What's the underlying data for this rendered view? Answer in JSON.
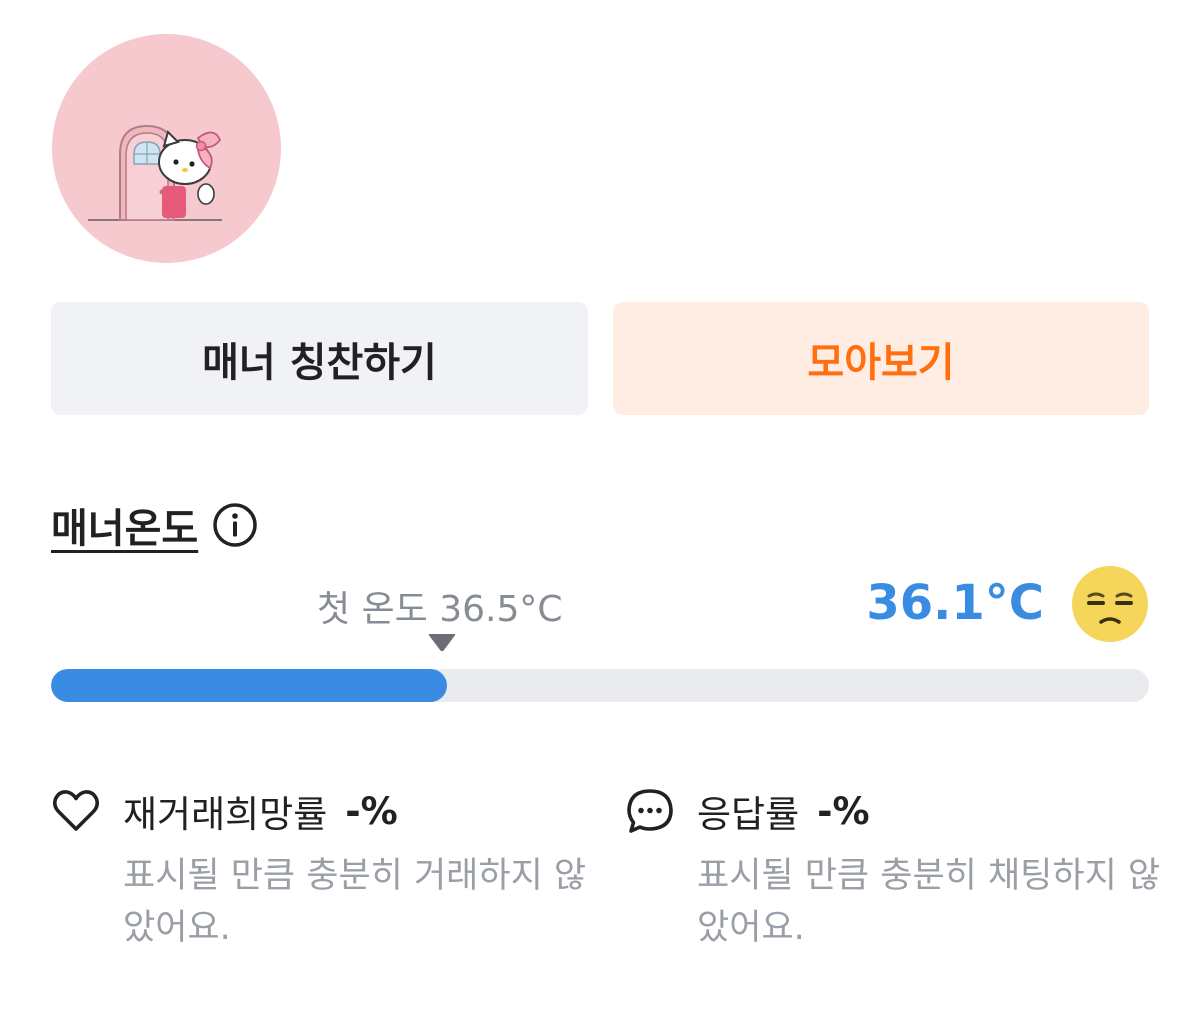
{
  "profile": {
    "avatar_icon": "hello-kitty-door-avatar",
    "avatar_bg": "#f5c9ce"
  },
  "buttons": {
    "praise_label": "매너 칭찬하기",
    "collect_label": "모아보기",
    "collect_color": "#ff6f0f"
  },
  "manner": {
    "title": "매너온도",
    "info_icon": "info-circle-icon",
    "first_temp_label": "첫 온도 36.5°C",
    "current_temp": "36.1°C",
    "temp_color": "#3a8ce3",
    "emoji_icon": "unamused-face-icon",
    "bar_fill_percent": 36.1
  },
  "stats": [
    {
      "icon": "heart-icon",
      "label": "재거래희망률",
      "value": "-%",
      "desc": "표시될 만큼 충분히 거래하지 않았어요."
    },
    {
      "icon": "chat-bubble-icon",
      "label": "응답률",
      "value": "-%",
      "desc": "표시될 만큼 충분히 채팅하지 않았어요."
    }
  ]
}
